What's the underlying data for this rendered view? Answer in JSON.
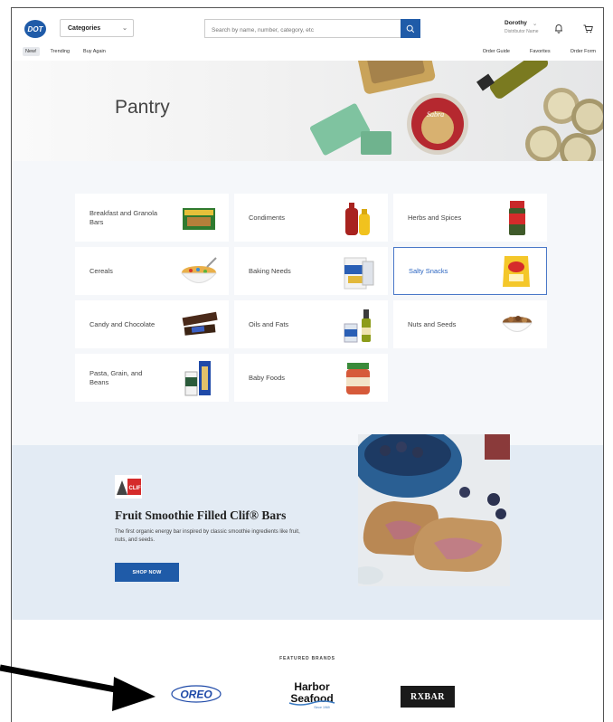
{
  "header": {
    "logo_text": "DOT",
    "categories_label": "Categories",
    "search_placeholder": "Search by name, number, category, etc",
    "user_name": "Dorothy",
    "user_sub": "Distributor Name"
  },
  "subnav": {
    "left": [
      "New!",
      "Trending",
      "Buy Again"
    ],
    "right": [
      "Order Guide",
      "Favorites",
      "Order Form"
    ]
  },
  "hero": {
    "title": "Pantry"
  },
  "categories": [
    {
      "label": "Breakfast and Granola Bars",
      "icon": "granola-bar-box-icon"
    },
    {
      "label": "Condiments",
      "icon": "ketchup-mustard-icon"
    },
    {
      "label": "Herbs and Spices",
      "icon": "spice-jar-icon"
    },
    {
      "label": "Cereals",
      "icon": "cereal-bowl-icon"
    },
    {
      "label": "Baking Needs",
      "icon": "flour-bag-icon"
    },
    {
      "label": "Salty Snacks",
      "icon": "chips-bag-icon",
      "selected": true
    },
    {
      "label": "Candy and Chocolate",
      "icon": "candy-bar-icon"
    },
    {
      "label": "Oils and Fats",
      "icon": "oil-bottle-icon"
    },
    {
      "label": "Nuts and Seeds",
      "icon": "nuts-bowl-icon"
    },
    {
      "label": "Pasta, Grain, and Beans",
      "icon": "pasta-box-icon"
    },
    {
      "label": "Baby Foods",
      "icon": "baby-food-jar-icon"
    }
  ],
  "promo": {
    "title": "Fruit Smoothie Filled Clif® Bars",
    "body": "The first organic energy bar inspired by classic smoothie ingredients like fruit, nuts, and seeds.",
    "button": "SHOP NOW",
    "logo_text": "CLIF"
  },
  "featured": {
    "label": "FEATURED BRANDS",
    "brands": [
      "OREO",
      "Harbor Seafood",
      "RXBAR"
    ],
    "harbor_line1": "Harbor",
    "harbor_line2": "Seafood",
    "harbor_tag": "Since 1969"
  },
  "colors": {
    "primary": "#1f5ba8",
    "selected_border": "#4a78c8",
    "promo_bg": "#e3ebf4"
  }
}
